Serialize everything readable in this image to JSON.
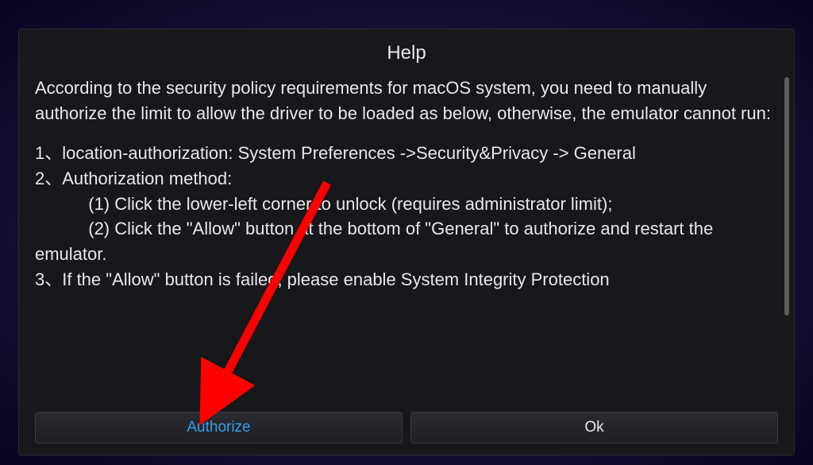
{
  "dialog": {
    "title": "Help",
    "intro": "According to the security policy requirements for macOS system, you need to manually authorize the limit to allow the driver to be loaded as below, otherwise, the emulator cannot run:",
    "step1": "1、location-authorization: System Preferences ->Security&Privacy -> General",
    "step2_header": "2、Authorization method:",
    "step2_sub1": "           (1) Click the lower-left corner to unlock (requires administrator limit);",
    "step2_sub2": "           (2) Click the \"Allow\" button at the bottom of \"General\" to authorize and restart the emulator.",
    "step3": "3、If the \"Allow\" button is failed, please enable System Integrity Protection"
  },
  "buttons": {
    "authorize_label": "Authorize",
    "ok_label": "Ok"
  }
}
